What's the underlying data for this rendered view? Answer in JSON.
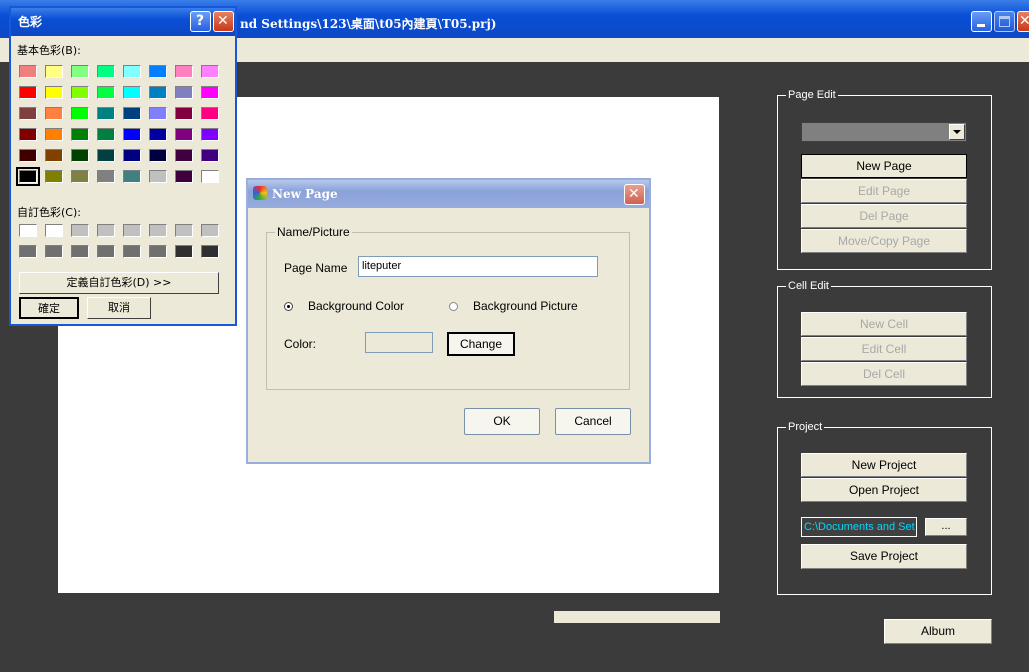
{
  "main_window": {
    "title": "nd Settings\\123\\桌面\\t05內建頁\\T05.prj)"
  },
  "right_panel": {
    "page_edit": {
      "label": "Page Edit",
      "dropdown_value": "",
      "new_page": "New Page",
      "edit_page": "Edit Page",
      "del_page": "Del Page",
      "move_copy_page": "Move/Copy Page"
    },
    "cell_edit": {
      "label": "Cell Edit",
      "new_cell": "New Cell",
      "edit_cell": "Edit Cell",
      "del_cell": "Del Cell"
    },
    "project": {
      "label": "Project",
      "new_project": "New Project",
      "open_project": "Open Project",
      "path_value": "C:\\Documents and Set",
      "browse": "...",
      "save_project": "Save Project"
    },
    "album": "Album"
  },
  "color_dialog": {
    "title": "色彩",
    "help_glyph": "?",
    "close_glyph": "✕",
    "basic_colors_label": "基本色彩(B):",
    "custom_colors_label": "自訂色彩(C):",
    "define_custom": "定義自訂色彩(D) >>",
    "ok": "確定",
    "cancel": "取消",
    "basic_colors": [
      [
        "#f08080",
        "#ffff80",
        "#80ff80",
        "#00ff80",
        "#80ffff",
        "#0080ff",
        "#ff80c0",
        "#ff80ff"
      ],
      [
        "#ff0000",
        "#ffff00",
        "#80ff00",
        "#00ff40",
        "#00ffff",
        "#0080c0",
        "#8080c0",
        "#ff00ff"
      ],
      [
        "#804040",
        "#ff8040",
        "#00ff00",
        "#008080",
        "#004080",
        "#8080ff",
        "#800040",
        "#ff0080"
      ],
      [
        "#800000",
        "#ff8000",
        "#008000",
        "#008040",
        "#0000ff",
        "#0000a0",
        "#800080",
        "#8000ff"
      ],
      [
        "#400000",
        "#804000",
        "#004000",
        "#004040",
        "#000080",
        "#000040",
        "#400040",
        "#400080"
      ],
      [
        "#000000",
        "#808000",
        "#808040",
        "#808080",
        "#408080",
        "#c0c0c0",
        "#400040",
        "#ffffff"
      ]
    ],
    "custom_colors": [
      [
        "#ffffff",
        "#ffffff",
        "#ffffff",
        "#ffffff",
        "#ffffff",
        "#ffffff",
        "#ffffff",
        "#ffffff"
      ],
      [
        "#ffffff",
        "#ffffff",
        "#ffffff",
        "#ffffff",
        "#ffffff",
        "#ffffff",
        "#ffffff",
        "#ffffff"
      ]
    ]
  },
  "new_page_dialog": {
    "title": "New Page",
    "close_glyph": "✕",
    "group_label": "Name/Picture",
    "page_name_label": "Page Name",
    "page_name_value": "liteputer",
    "bg_color_label": "Background Color",
    "bg_picture_label": "Background Picture",
    "color_label": "Color:",
    "change": "Change",
    "ok": "OK",
    "cancel": "Cancel"
  },
  "colors": {
    "xp_title_blue": "#0a4fd6",
    "workspace_dark": "#3b3b3b",
    "path_text_cyan": "#00d8ff"
  }
}
